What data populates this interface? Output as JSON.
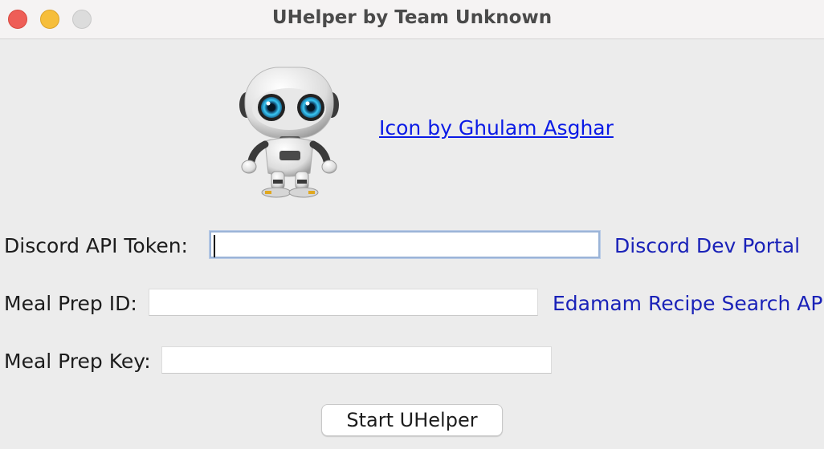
{
  "window": {
    "title": "UHelper by Team Unknown"
  },
  "header": {
    "icon_credit": "Icon by Ghulam Asghar"
  },
  "form": {
    "discord": {
      "label": "Discord API Token:",
      "value": "",
      "link": "Discord Dev Portal"
    },
    "meal_id": {
      "label": "Meal Prep ID:",
      "value": "",
      "link": "Edamam Recipe Search API"
    },
    "meal_key": {
      "label": "Meal Prep Key:",
      "value": ""
    }
  },
  "actions": {
    "start_label": "Start UHelper"
  },
  "colors": {
    "link": "#0a1ae6",
    "link_plain": "#1a22b8",
    "close": "#ee5e57",
    "minimize": "#f6be3b"
  }
}
